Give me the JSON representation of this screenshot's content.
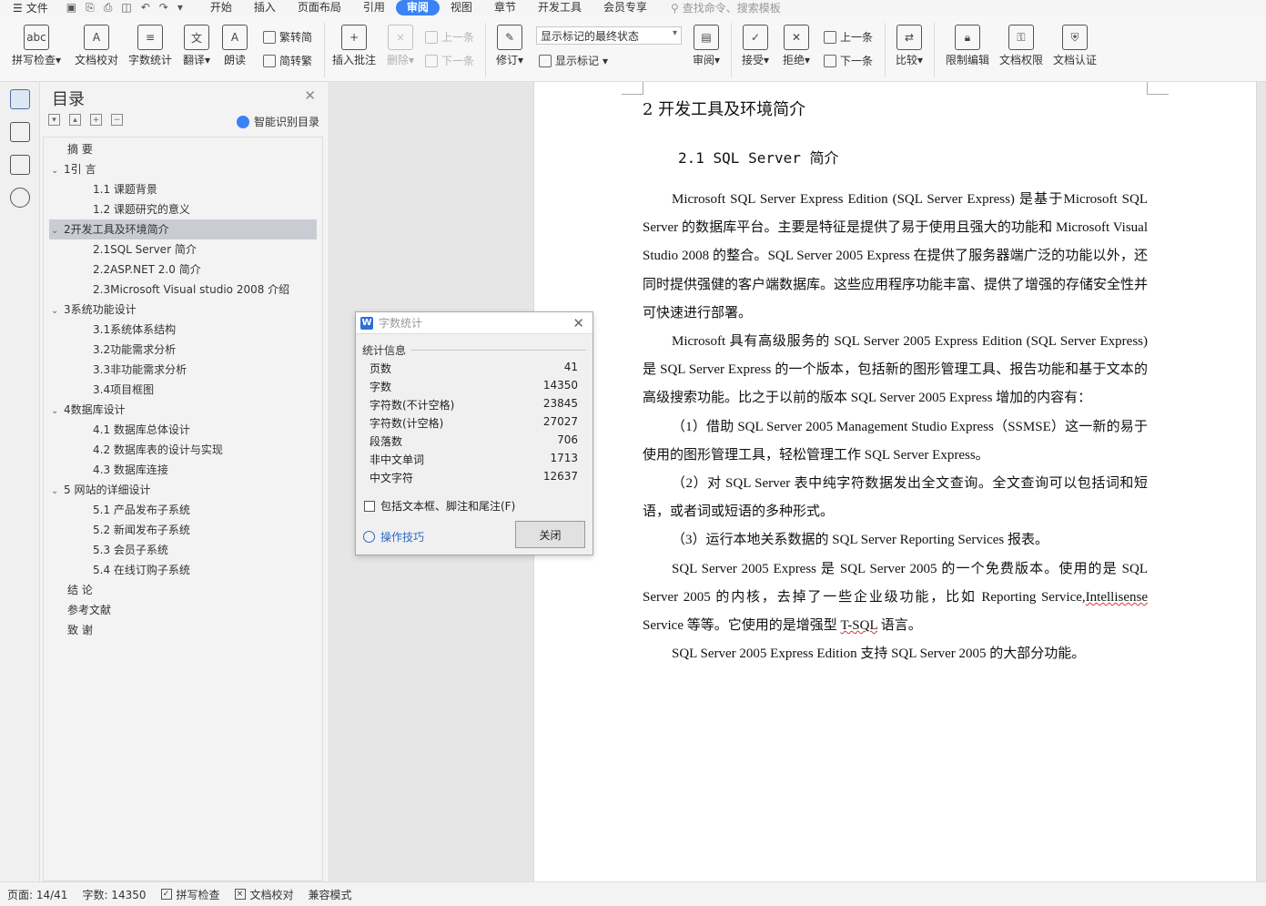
{
  "menubar": {
    "file_label": "文件",
    "tabs": [
      "开始",
      "插入",
      "页面布局",
      "引用",
      "审阅",
      "视图",
      "章节",
      "开发工具",
      "会员专享"
    ],
    "active_tab": "审阅",
    "search_placeholder": "查找命令、搜索模板"
  },
  "ribbon": {
    "spellcheck": "拼写检查",
    "doc_proofread": "文档校对",
    "word_count": "字数统计",
    "translate": "翻译",
    "read_aloud": "朗读",
    "trad_to_simp": "繁转简",
    "simp_to_trad": "简转繁",
    "insert_comment": "插入批注",
    "delete": "删除",
    "prev_comment": "上一条",
    "next_comment": "下一条",
    "track_changes": "修订",
    "markup_combo": "显示标记的最终状态",
    "show_markup": "显示标记",
    "review": "审阅",
    "accept": "接受",
    "reject": "拒绝",
    "prev_change": "上一条",
    "next_change": "下一条",
    "compare": "比较",
    "restrict_edit": "限制编辑",
    "doc_permission": "文档权限",
    "doc_certify": "文档认证"
  },
  "toc": {
    "title": "目录",
    "smart_label": "智能识别目录",
    "items": [
      {
        "label": "摘 要",
        "level": 1,
        "chev": ""
      },
      {
        "label": "1引 言",
        "level": 1,
        "chev": "v"
      },
      {
        "label": "1.1 课题背景",
        "level": 2,
        "chev": ""
      },
      {
        "label": "1.2  课题研究的意义",
        "level": 2,
        "chev": ""
      },
      {
        "label": "2开发工具及环境简介",
        "level": 1,
        "chev": "v",
        "selected": true
      },
      {
        "label": "2.1SQL Server  简介",
        "level": 2,
        "chev": ""
      },
      {
        "label": "2.2ASP.NET 2.0 简介",
        "level": 2,
        "chev": ""
      },
      {
        "label": "2.3Microsoft Visual studio 2008  介绍",
        "level": 2,
        "chev": ""
      },
      {
        "label": "3系统功能设计",
        "level": 1,
        "chev": "v"
      },
      {
        "label": "3.1系统体系结构",
        "level": 2,
        "chev": ""
      },
      {
        "label": "3.2功能需求分析",
        "level": 2,
        "chev": ""
      },
      {
        "label": "3.3非功能需求分析",
        "level": 2,
        "chev": ""
      },
      {
        "label": "3.4项目框图",
        "level": 2,
        "chev": ""
      },
      {
        "label": "4数据库设计",
        "level": 1,
        "chev": "v"
      },
      {
        "label": "4.1 数据库总体设计",
        "level": 2,
        "chev": ""
      },
      {
        "label": "4.2 数据库表的设计与实现",
        "level": 2,
        "chev": ""
      },
      {
        "label": "4.3  数据库连接",
        "level": 2,
        "chev": ""
      },
      {
        "label": "5 网站的详细设计",
        "level": 1,
        "chev": "v"
      },
      {
        "label": "5.1 产品发布子系统",
        "level": 2,
        "chev": ""
      },
      {
        "label": "5.2 新闻发布子系统",
        "level": 2,
        "chev": ""
      },
      {
        "label": "5.3  会员子系统",
        "level": 2,
        "chev": ""
      },
      {
        "label": "5.4 在线订购子系统",
        "level": 2,
        "chev": ""
      },
      {
        "label": "结 论",
        "level": 1,
        "chev": ""
      },
      {
        "label": "参考文献",
        "level": 1,
        "chev": ""
      },
      {
        "label": "致 谢",
        "level": 1,
        "chev": ""
      }
    ]
  },
  "document": {
    "heading1": "2  开发工具及环境简介",
    "heading2": "2.1  SQL Server  简介",
    "p1": "Microsoft SQL Server  Express Edition (SQL Server Express) 是基于Microsoft SQL Server 的数据库平台。主要是特征是提供了易于使用且强大的功能和 Microsoft Visual Studio 2008 的整合。SQL Server 2005 Express 在提供了服务器端广泛的功能以外，还同时提供强健的客户端数据库。这些应用程序功能丰富、提供了增强的存储安全性并可快速进行部署。",
    "p2": "Microsoft 具有高级服务的  SQL Server 2005 Express Edition (SQL Server Express) 是 SQL Server Express 的一个版本，包括新的图形管理工具、报告功能和基于文本的高级搜索功能。比之于以前的版本 SQL Server 2005 Express 增加的内容有：",
    "p3": "（1）借助 SQL Server 2005 Management Studio Express（SSMSE）这一新的易于使用的图形管理工具，轻松管理工作 SQL Server Express。",
    "p4": "（2）对 SQL Server 表中纯字符数据发出全文查询。全文查询可以包括词和短语，或者词或短语的多种形式。",
    "p5": "（3）运行本地关系数据的 SQL Server Reporting Services 报表。",
    "p6a": "SQL Server 2005 Express 是 SQL Server 2005 的一个免费版本。使用的是 SQL Server 2005 的内核，去掉了一些企业级功能，比如 Reporting Service,",
    "p6b": "Intellisense",
    "p6c": " Service 等等。它使用的是增强型 ",
    "p6d": "T-SQL",
    "p6e": " 语言。",
    "p7": "SQL Server 2005 Express Edition 支持 SQL Server 2005 的大部分功能。"
  },
  "dialog": {
    "title": "字数统计",
    "section": "统计信息",
    "rows": [
      {
        "label": "页数",
        "value": "41"
      },
      {
        "label": "字数",
        "value": "14350"
      },
      {
        "label": "字符数(不计空格)",
        "value": "23845"
      },
      {
        "label": "字符数(计空格)",
        "value": "27027"
      },
      {
        "label": "段落数",
        "value": "706"
      },
      {
        "label": "非中文单词",
        "value": "1713"
      },
      {
        "label": "中文字符",
        "value": "12637"
      }
    ],
    "checkbox_label": "包括文本框、脚注和尾注(F)",
    "tips_label": "操作技巧",
    "close_button": "关闭"
  },
  "status": {
    "page": "页面: 14/41",
    "words": "字数: 14350",
    "spellcheck": "拼写检查",
    "proofread": "文档校对",
    "compat": "兼容模式"
  }
}
